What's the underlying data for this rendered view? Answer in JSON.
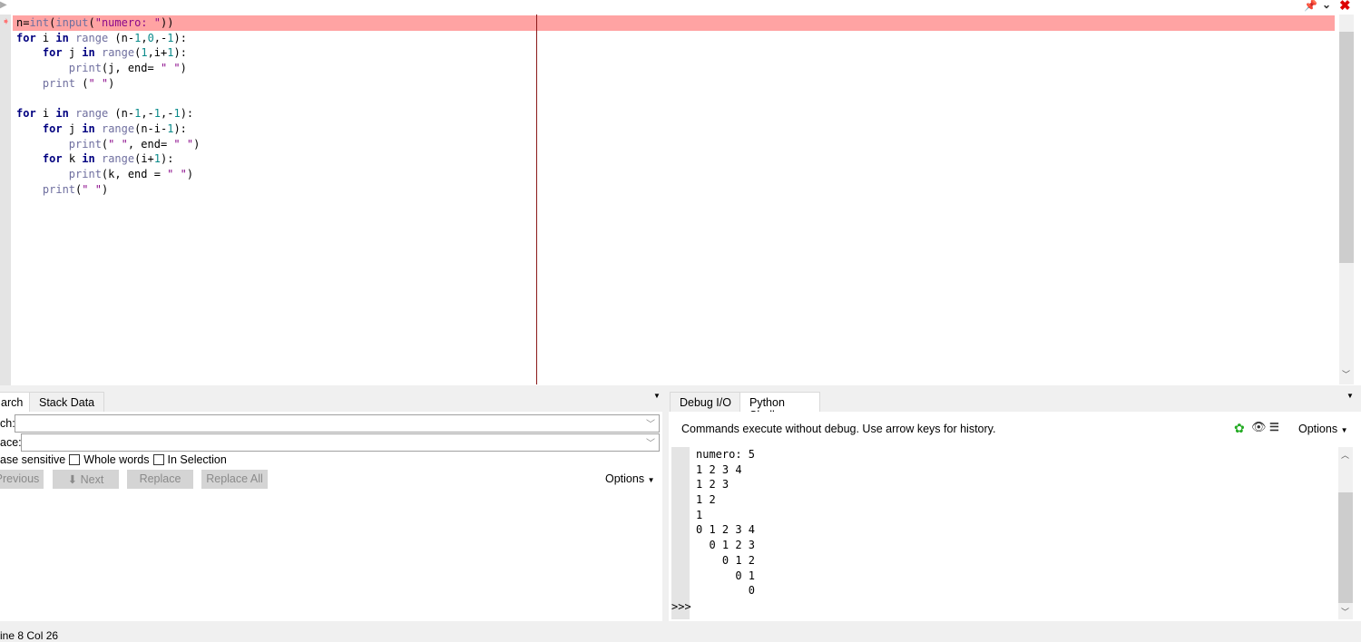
{
  "editor": {
    "code_lines": [
      [
        [
          "n=",
          "op"
        ],
        [
          "int",
          "bi"
        ],
        [
          "(",
          "op"
        ],
        [
          "input",
          "bi"
        ],
        [
          "(",
          "op"
        ],
        [
          "\"numero: \"",
          "str"
        ],
        [
          "))",
          "op"
        ]
      ],
      [
        [
          "for",
          "kw"
        ],
        [
          " i ",
          "op"
        ],
        [
          "in",
          "kw"
        ],
        [
          " ",
          "op"
        ],
        [
          "range",
          "bi"
        ],
        [
          " (n-",
          "op"
        ],
        [
          "1",
          "num"
        ],
        [
          ",",
          "op"
        ],
        [
          "0",
          "num"
        ],
        [
          ",-",
          "op"
        ],
        [
          "1",
          "num"
        ],
        [
          "):",
          "op"
        ]
      ],
      [
        [
          "    ",
          "op"
        ],
        [
          "for",
          "kw"
        ],
        [
          " j ",
          "op"
        ],
        [
          "in",
          "kw"
        ],
        [
          " ",
          "op"
        ],
        [
          "range",
          "bi"
        ],
        [
          "(",
          "op"
        ],
        [
          "1",
          "num"
        ],
        [
          ",i+",
          "op"
        ],
        [
          "1",
          "num"
        ],
        [
          "):",
          "op"
        ]
      ],
      [
        [
          "        ",
          "op"
        ],
        [
          "print",
          "bi"
        ],
        [
          "(j, end= ",
          "op"
        ],
        [
          "\" \"",
          "str"
        ],
        [
          ")",
          "op"
        ]
      ],
      [
        [
          "    ",
          "op"
        ],
        [
          "print",
          "bi"
        ],
        [
          " (",
          "op"
        ],
        [
          "\" \"",
          "str"
        ],
        [
          ")",
          "op"
        ]
      ],
      [
        [
          "",
          "op"
        ]
      ],
      [
        [
          "for",
          "kw"
        ],
        [
          " i ",
          "op"
        ],
        [
          "in",
          "kw"
        ],
        [
          " ",
          "op"
        ],
        [
          "range",
          "bi"
        ],
        [
          " (n-",
          "op"
        ],
        [
          "1",
          "num"
        ],
        [
          ",-",
          "op"
        ],
        [
          "1",
          "num"
        ],
        [
          ",-",
          "op"
        ],
        [
          "1",
          "num"
        ],
        [
          "):",
          "op"
        ]
      ],
      [
        [
          "    ",
          "op"
        ],
        [
          "for",
          "kw"
        ],
        [
          " j ",
          "op"
        ],
        [
          "in",
          "kw"
        ],
        [
          " ",
          "op"
        ],
        [
          "range",
          "bi"
        ],
        [
          "(n-i-",
          "op"
        ],
        [
          "1",
          "num"
        ],
        [
          "):",
          "op"
        ]
      ],
      [
        [
          "        ",
          "op"
        ],
        [
          "print",
          "bi"
        ],
        [
          "(",
          "op"
        ],
        [
          "\" \"",
          "str"
        ],
        [
          ", end= ",
          "op"
        ],
        [
          "\" \"",
          "str"
        ],
        [
          ")",
          "op"
        ]
      ],
      [
        [
          "    ",
          "op"
        ],
        [
          "for",
          "kw"
        ],
        [
          " k ",
          "op"
        ],
        [
          "in",
          "kw"
        ],
        [
          " ",
          "op"
        ],
        [
          "range",
          "bi"
        ],
        [
          "(i+",
          "op"
        ],
        [
          "1",
          "num"
        ],
        [
          "):",
          "op"
        ]
      ],
      [
        [
          "        ",
          "op"
        ],
        [
          "print",
          "bi"
        ],
        [
          "(k, end = ",
          "op"
        ],
        [
          "\" \"",
          "str"
        ],
        [
          ")",
          "op"
        ]
      ],
      [
        [
          "    ",
          "op"
        ],
        [
          "print",
          "bi"
        ],
        [
          "(",
          "op"
        ],
        [
          "\" \"",
          "str"
        ],
        [
          ")",
          "op"
        ]
      ]
    ],
    "highlight_color": "#ffa3a3"
  },
  "search_panel": {
    "tabs": [
      "arch",
      "Stack Data"
    ],
    "search_label": "ch:",
    "replace_label": "ace:",
    "search_value": "",
    "replace_value": "",
    "case_label": "ase sensitive",
    "whole_words_label": "Whole words",
    "in_selection_label": "In Selection",
    "previous": "Previous",
    "next": "Next",
    "replace": "Replace",
    "replace_all": "Replace All",
    "options": "Options"
  },
  "shell_panel": {
    "tabs": [
      "Debug I/O",
      "Python Shell"
    ],
    "info": "Commands execute without debug.  Use arrow keys for history.",
    "options": "Options",
    "output": [
      "numero: 5",
      "1 2 3 4",
      "1 2 3",
      "1 2",
      "1",
      "0 1 2 3 4",
      "  0 1 2 3",
      "    0 1 2",
      "      0 1",
      "        0"
    ],
    "prompt": ">>>"
  },
  "status": {
    "position": "ine 8 Col 26"
  }
}
